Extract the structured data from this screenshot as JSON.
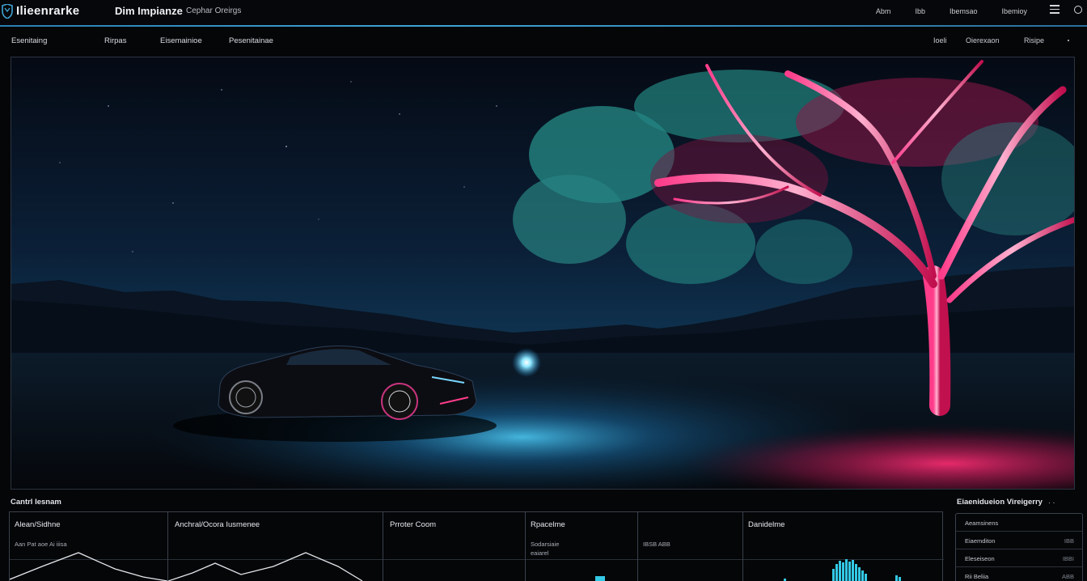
{
  "header": {
    "brand": "Ilieenrarke",
    "title": "Dim Impianze",
    "subtitle": "Cephar Oreirgs",
    "links": [
      "Abm",
      "Ibb",
      "Ibemsao",
      "Ibemioy"
    ]
  },
  "nav": {
    "left": [
      "Esenitaing",
      "Rirpas",
      "Eisemainioe",
      "Pesenitainae"
    ],
    "right": [
      "Ioeli",
      "Oierexaon",
      "Risipe"
    ]
  },
  "hero": {
    "alt_desc_colors": {
      "accent_pink": "#ff1f6a",
      "accent_cyan": "#3fc6d8",
      "sky": "#0b1a2e"
    }
  },
  "control": {
    "title": "Cantrl Iesnam",
    "columns": [
      {
        "head": "Alean/Sidhne",
        "sub": "Aan Pat aoe Ai iiisa"
      },
      {
        "head": "Anchral/Ocora Iusmenee",
        "sub": ""
      },
      {
        "head": "Prroter Coom",
        "sub": ""
      },
      {
        "head": "Rpacelme",
        "sub": "Sodarsiaie",
        "sub2": "eaiarel"
      },
      {
        "head": "",
        "sub": "IBSB  ABB"
      },
      {
        "head": "Danidelme",
        "sub": ""
      }
    ]
  },
  "side": {
    "title": "Eiaenidueion Vireigerry",
    "rows": [
      {
        "k": "Aeamsinens",
        "v": ""
      },
      {
        "k": "Eiaemditon",
        "v": "IBB"
      },
      {
        "k": "Eleseiseon",
        "v": "IBBI"
      },
      {
        "k": "Rii Beliia",
        "v": "ABB"
      }
    ]
  },
  "colors": {
    "accent": "#3fa3d6",
    "pink": "#ff2a75",
    "cyan": "#33c9e6"
  }
}
